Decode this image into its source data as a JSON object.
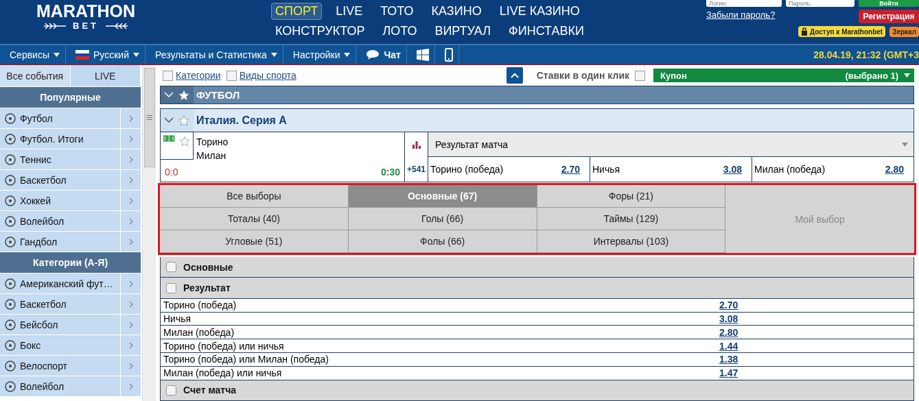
{
  "header": {
    "logo": {
      "title": "MARATHON",
      "subtitle": "BET"
    },
    "nav": [
      {
        "label": "СПОРТ",
        "selected": true
      },
      {
        "label": "LIVE",
        "selected": false
      },
      {
        "label": "ТОТО",
        "selected": false
      },
      {
        "label": "КАЗИНО",
        "selected": false
      },
      {
        "label": "LIVE КАЗИНО",
        "selected": false
      },
      {
        "label": "КОНСТРУКТОР",
        "selected": false
      },
      {
        "label": "ЛОТО",
        "selected": false
      },
      {
        "label": "ВИРТУАЛ",
        "selected": false
      },
      {
        "label": "ФИНСТАВКИ",
        "selected": false
      }
    ],
    "login": {
      "login_placeholder": "Логин:",
      "password_placeholder": "Пароль:",
      "login_button": "Войти",
      "forgot_link": "Забыли пароль?",
      "register_button": "Регистрация",
      "access_badge": "Доступ к Marathonbet",
      "mirror_badge": "Зеркал"
    }
  },
  "navbar": {
    "items": [
      {
        "kind": "dropdown",
        "label": "Сервисы"
      },
      {
        "kind": "language",
        "label": "Русский"
      },
      {
        "kind": "dropdown",
        "label": "Результаты и Статистика"
      },
      {
        "kind": "dropdown",
        "label": "Настройки"
      },
      {
        "kind": "chat",
        "label": "Чат"
      },
      {
        "kind": "windows"
      },
      {
        "kind": "phone"
      }
    ],
    "datetime": "28.04.19, 21:32 (GMT+3"
  },
  "sidebar": {
    "tabs": [
      {
        "label": "Все события",
        "selected": true
      },
      {
        "label": "LIVE",
        "selected": false
      }
    ],
    "sections": [
      {
        "title": "Популярные",
        "items": [
          {
            "label": "Футбол"
          },
          {
            "label": "Футбол. Итоги"
          },
          {
            "label": "Теннис"
          },
          {
            "label": "Баскетбол"
          },
          {
            "label": "Хоккей"
          },
          {
            "label": "Волейбол"
          },
          {
            "label": "Гандбол"
          }
        ]
      },
      {
        "title": "Категории (А-Я)",
        "items": [
          {
            "label": "Американский фут…"
          },
          {
            "label": "Баскетбол"
          },
          {
            "label": "Бейсбол"
          },
          {
            "label": "Бокс"
          },
          {
            "label": "Велоспорт"
          },
          {
            "label": "Волейбол"
          }
        ]
      }
    ]
  },
  "toolbar": {
    "filters": [
      {
        "label": "Категории",
        "checked": false
      },
      {
        "label": "Виды спорта",
        "checked": false
      }
    ],
    "one_click": {
      "label": "Ставки в один клик",
      "checked": false
    },
    "coupon": {
      "title": "Купон",
      "count": "(выбрано 1)"
    }
  },
  "sport": {
    "title": "ФУТБОЛ"
  },
  "league": {
    "title": "Италия. Серия А"
  },
  "match": {
    "home": "Торино",
    "away": "Милан",
    "score": "0:0",
    "time": "0:30",
    "more": "+541",
    "market": "Результат матча",
    "odds": [
      {
        "label": "Торино (победа)",
        "value": "2.70"
      },
      {
        "label": "Ничья",
        "value": "3.08"
      },
      {
        "label": "Милан (победа)",
        "value": "2.80"
      }
    ]
  },
  "market_tabs": [
    {
      "label": "Все выборы",
      "selected": false
    },
    {
      "label": "Основные (67)",
      "selected": true
    },
    {
      "label": "Форы (21)",
      "selected": false
    },
    {
      "label": "Тоталы (40)",
      "selected": false
    },
    {
      "label": "Голы (66)",
      "selected": false
    },
    {
      "label": "Таймы (129)",
      "selected": false
    },
    {
      "label": "Угловые (51)",
      "selected": false
    },
    {
      "label": "Фолы (66)",
      "selected": false
    },
    {
      "label": "Интервалы (103)",
      "selected": false
    }
  ],
  "my_choice": "Мой выбор",
  "groups": [
    {
      "title": "Основные",
      "checked": false
    },
    {
      "title": "Результат",
      "checked": false,
      "rows": [
        {
          "label": "Торино (победа)",
          "value": "2.70"
        },
        {
          "label": "Ничья",
          "value": "3.08"
        },
        {
          "label": "Милан (победа)",
          "value": "2.80"
        },
        {
          "label": "Торино (победа) или ничья",
          "value": "1.44"
        },
        {
          "label": "Торино (победа) или Милан (победа)",
          "value": "1.38"
        },
        {
          "label": "Милан (победа) или ничья",
          "value": "1.47"
        }
      ]
    },
    {
      "title": "Счет матча",
      "checked": false
    }
  ]
}
